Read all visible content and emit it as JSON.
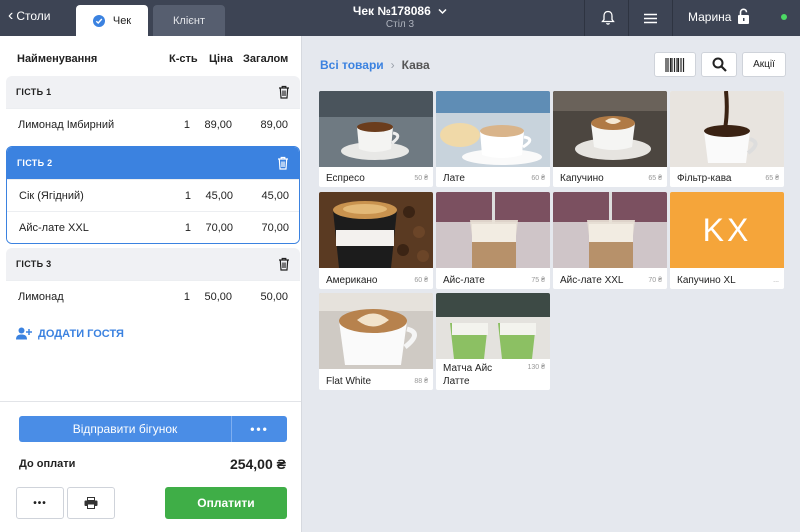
{
  "topbar": {
    "back_label": "Столи",
    "tab_check": "Чек",
    "tab_client": "Клієнт",
    "order_title": "Чек №178086",
    "order_subtitle": "Стіл 3",
    "user_name": "Марина",
    "icons": [
      "chevron-left-icon",
      "check-icon",
      "chevron-down-icon",
      "bell-icon",
      "menu-icon",
      "unlock-icon"
    ],
    "status_color": "#4cd964"
  },
  "order": {
    "columns": {
      "name": "Найменування",
      "qty": "К-сть",
      "price": "Ціна",
      "total": "Загалом"
    },
    "guests": [
      {
        "label": "ГІСТЬ 1",
        "selected": false,
        "items": [
          {
            "name": "Лимонад Імбирний",
            "qty": "1",
            "price": "89,00",
            "total": "89,00"
          }
        ]
      },
      {
        "label": "ГІСТЬ 2",
        "selected": true,
        "items": [
          {
            "name": "Сік (Ягідний)",
            "qty": "1",
            "price": "45,00",
            "total": "45,00"
          },
          {
            "name": "Айс-лате XXL",
            "qty": "1",
            "price": "70,00",
            "total": "70,00"
          }
        ]
      },
      {
        "label": "ГІСТЬ 3",
        "selected": false,
        "items": [
          {
            "name": "Лимонад",
            "qty": "1",
            "price": "50,00",
            "total": "50,00"
          }
        ]
      }
    ],
    "add_guest_label": "ДОДАТИ ГОСТЯ",
    "send_button": "Відправити бігунок",
    "more_dots": "•••",
    "due_label": "До оплати",
    "due_value": "254,00 ₴",
    "small_more": "•••",
    "pay_button": "Оплатити"
  },
  "catalog": {
    "breadcrumb_root": "Всі товари",
    "breadcrumb_sep": "›",
    "breadcrumb_current": "Кава",
    "promo_button": "Акції",
    "accent_color": "#3b82e0",
    "products": [
      {
        "name": "Еспресо",
        "price": "50 ₴"
      },
      {
        "name": "Лате",
        "price": "60 ₴"
      },
      {
        "name": "Капучино",
        "price": "65 ₴"
      },
      {
        "name": "Фільтр-кава",
        "price": "65 ₴"
      },
      {
        "name": "Американо",
        "price": "60 ₴"
      },
      {
        "name": "Айс-лате",
        "price": "75 ₴"
      },
      {
        "name": "Айс-лате XXL",
        "price": "70 ₴"
      },
      {
        "name": "Капучино XL",
        "price": "...",
        "placeholder": "KX",
        "placeholder_color": "#f5a53a"
      },
      {
        "name": "Flat White",
        "price": "88 ₴"
      },
      {
        "name": "Матча Айс Латте",
        "price": "130 ₴"
      }
    ]
  }
}
